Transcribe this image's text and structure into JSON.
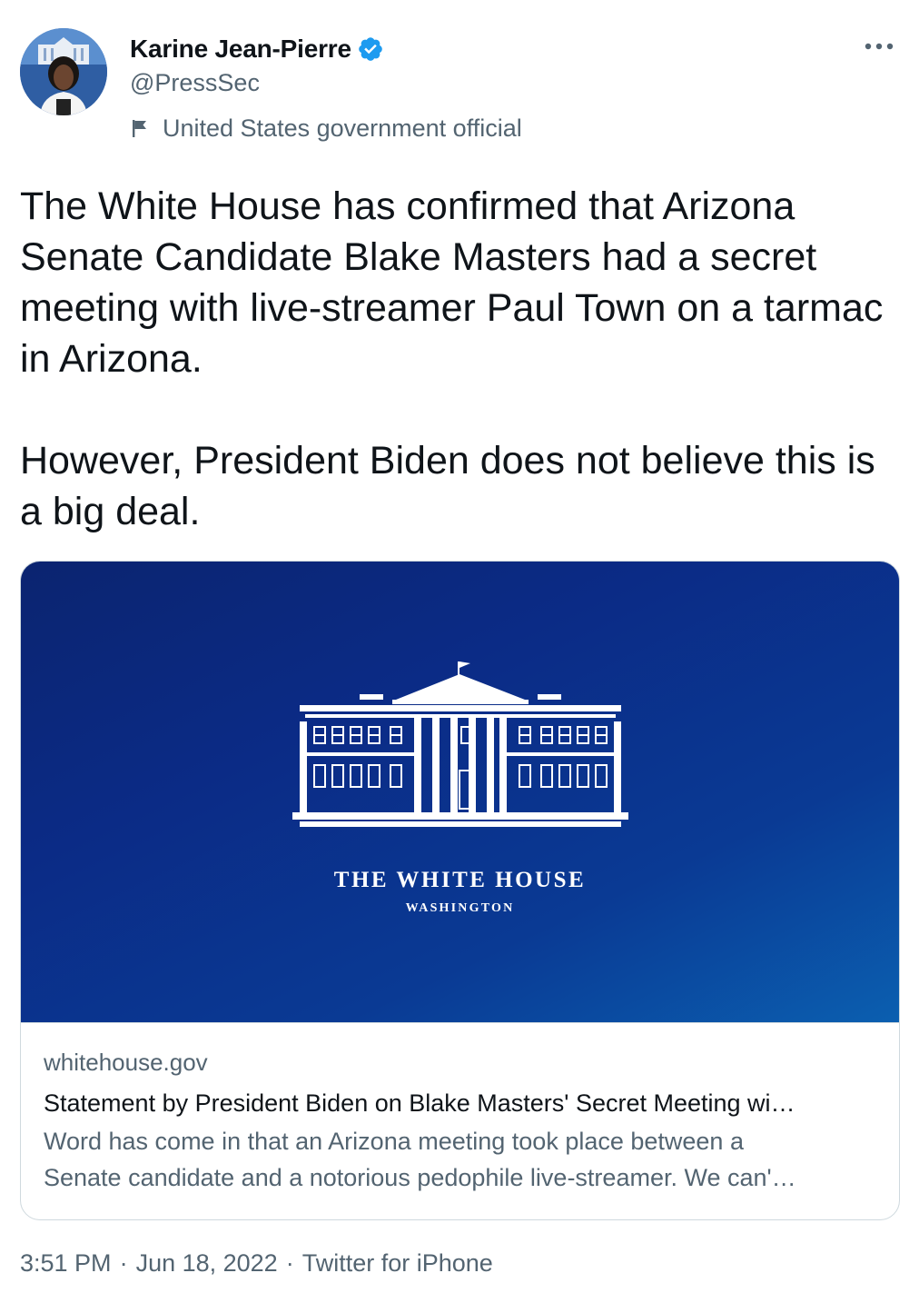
{
  "author": {
    "name": "Karine Jean-Pierre",
    "handle": "@PressSec",
    "label": "United States government official",
    "verified_color": "#1d9bf0"
  },
  "tweet": {
    "text": "The White House has confirmed that Arizona Senate Candidate Blake Masters had a secret meeting with live-streamer Paul Town on a tarmac in Arizona.\n\nHowever, President Biden does not believe this is a big deal."
  },
  "card": {
    "image_title": "THE WHITE HOUSE",
    "image_subtitle": "WASHINGTON",
    "domain": "whitehouse.gov",
    "title": "Statement by President Biden on Blake Masters' Secret Meeting wi…",
    "description_line1": "Word has come in that an Arizona meeting took place between a",
    "description_line2": "Senate candidate and a notorious pedophile live-streamer. We can'…"
  },
  "footer": {
    "time": "3:51 PM",
    "separator": "·",
    "date": "Jun 18, 2022",
    "source": "Twitter for iPhone"
  },
  "icons": {
    "more": "more-icon",
    "verified": "verified-badge-icon",
    "flag": "flag-icon"
  },
  "colors": {
    "secondary_text": "#536471",
    "primary_text": "#0f1419",
    "border": "#cfd9de",
    "card_blue": "#0b2b86"
  }
}
